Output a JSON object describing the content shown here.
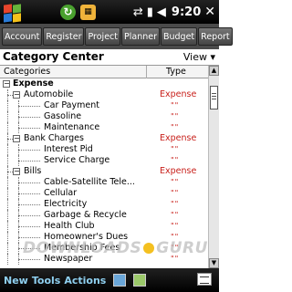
{
  "status": {
    "start_icon": "windows-flag-icon",
    "sync_icon": "sync-icon",
    "calendar_icon": "calendar-icon",
    "connectivity_icon": "arrows-connectivity-icon",
    "signal_icon": "signal-icon",
    "volume_icon": "speaker-icon",
    "time": "9:20",
    "close_icon": "close-icon"
  },
  "tabs": [
    "Account",
    "Register",
    "Project",
    "Planner",
    "Budget",
    "Report"
  ],
  "header": {
    "title": "Category Center",
    "view_label": "View"
  },
  "columns": {
    "category": "Categories",
    "type": "Type"
  },
  "tree": [
    {
      "label": "Expense",
      "level": 0,
      "expander": "−",
      "type": ""
    },
    {
      "label": "Automobile",
      "level": 1,
      "expander": "−",
      "type": "Expense"
    },
    {
      "label": "Car Payment",
      "level": 2,
      "type": "\"\""
    },
    {
      "label": "Gasoline",
      "level": 2,
      "type": "\"\""
    },
    {
      "label": "Maintenance",
      "level": 2,
      "type": "\"\""
    },
    {
      "label": "Bank Charges",
      "level": 1,
      "expander": "−",
      "type": "Expense"
    },
    {
      "label": "Interest Pid",
      "level": 2,
      "type": "\"\""
    },
    {
      "label": "Service Charge",
      "level": 2,
      "type": "\"\""
    },
    {
      "label": "Bills",
      "level": 1,
      "expander": "−",
      "type": "Expense"
    },
    {
      "label": "Cable-Satellite Tele...",
      "level": 2,
      "type": "\"\""
    },
    {
      "label": "Cellular",
      "level": 2,
      "type": "\"\""
    },
    {
      "label": "Electricity",
      "level": 2,
      "type": "\"\""
    },
    {
      "label": "Garbage & Recycle",
      "level": 2,
      "type": "\"\""
    },
    {
      "label": "Health Club",
      "level": 2,
      "type": "\"\""
    },
    {
      "label": "Homeowner's Dues",
      "level": 2,
      "type": "\"\""
    },
    {
      "label": "Membership Fees",
      "level": 2,
      "type": "\"\""
    },
    {
      "label": "Newspaper",
      "level": 2,
      "type": "\"\""
    }
  ],
  "watermark": {
    "left": "DOWNLOADS",
    "right": "GURU"
  },
  "menubar": {
    "new": "New",
    "tools": "Tools",
    "actions": "Actions"
  },
  "colors": {
    "expense_red": "#c8201b",
    "menu_blue": "#8fd0f0"
  }
}
